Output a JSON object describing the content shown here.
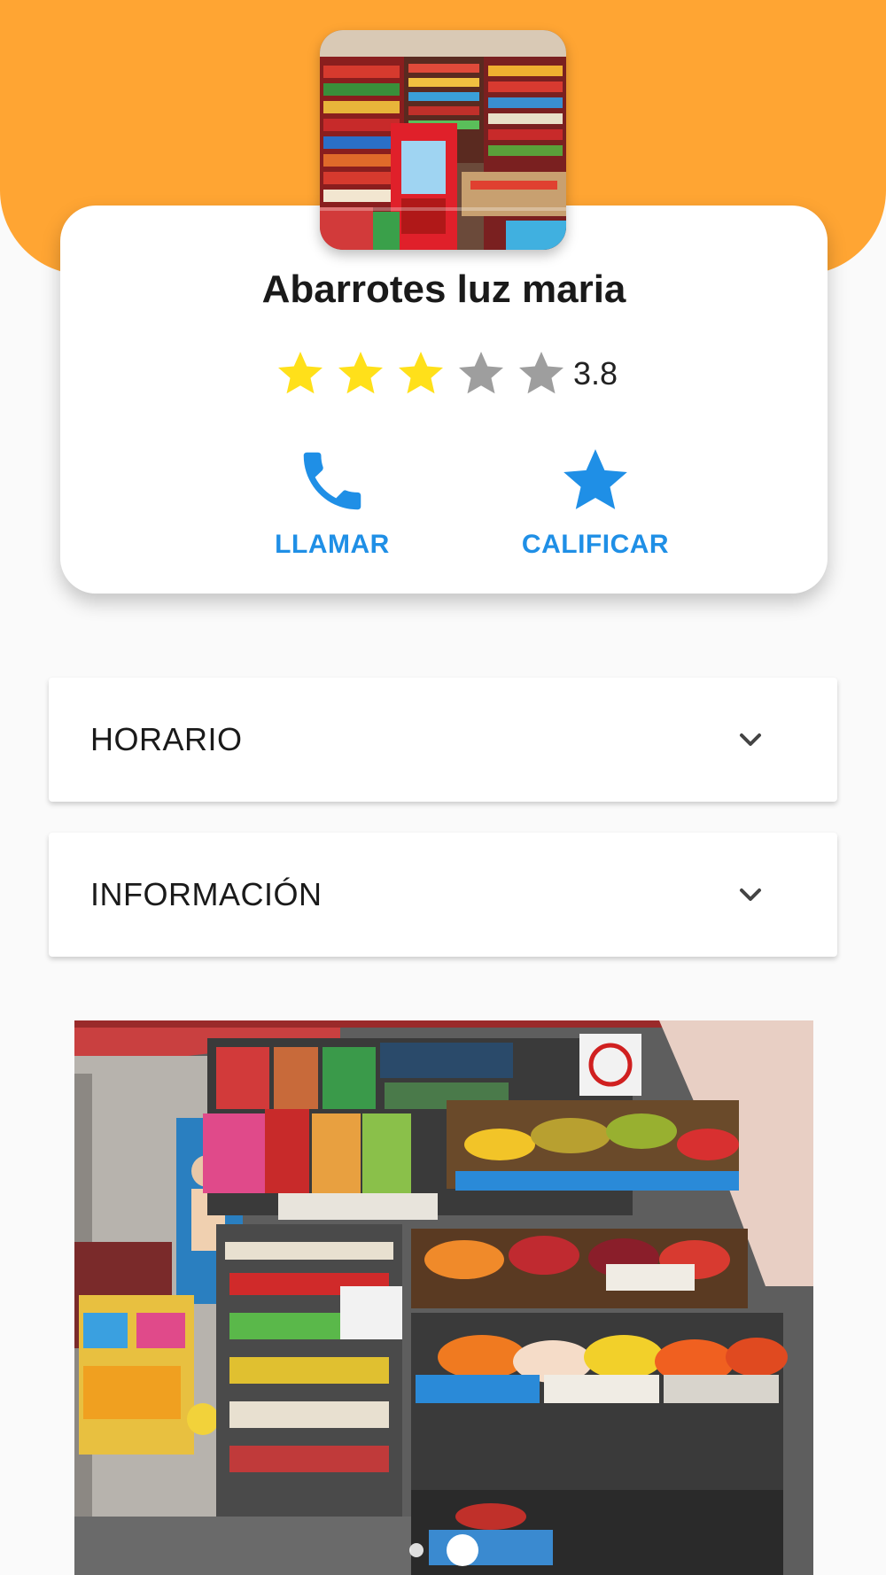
{
  "colors": {
    "header": "#ffa533",
    "accent": "#1f8fe6",
    "star_filled": "#ffe01a",
    "star_empty": "#9e9e9e"
  },
  "store": {
    "name": "Abarrotes luz maria",
    "rating": 3.8,
    "rating_text": "3.8",
    "stars_filled": 3,
    "stars_total": 5,
    "photo_icon": "store-interior-photo"
  },
  "actions": {
    "call": {
      "label": "LLAMAR",
      "icon": "phone-icon"
    },
    "rate": {
      "label": "CALIFICAR",
      "icon": "star-icon"
    }
  },
  "sections": {
    "schedule": {
      "title": "HORARIO",
      "icon": "chevron-down-icon"
    },
    "info": {
      "title": "INFORMACIÓN",
      "icon": "chevron-down-icon"
    }
  },
  "gallery": {
    "photo_icon": "storefront-produce-photo",
    "page_count": 2,
    "active_page": 2
  }
}
